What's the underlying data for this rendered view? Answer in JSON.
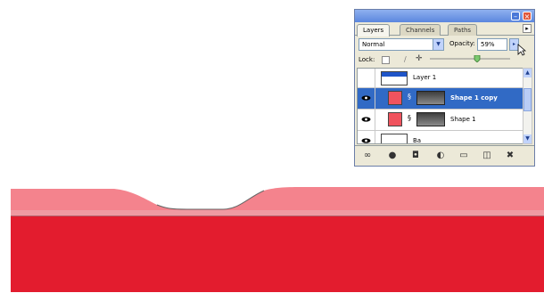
{
  "canvas": {
    "colors": {
      "background": "#ffffff",
      "main_shape": "#e31c2e",
      "shape_copy": "#f4838d",
      "band": "#ef9aa2"
    }
  },
  "layers_panel": {
    "tabs": [
      {
        "label": "Layers",
        "active": true
      },
      {
        "label": "Channels",
        "active": false
      },
      {
        "label": "Paths",
        "active": false
      }
    ],
    "blend_mode": "Normal",
    "opacity_label": "Opacity:",
    "opacity_value": "59%",
    "lock_label": "Lock:",
    "layers": [
      {
        "name": "Layer 1",
        "visible": false,
        "selected": false
      },
      {
        "name": "Shape 1 copy",
        "visible": true,
        "selected": true
      },
      {
        "name": "Shape 1",
        "visible": true,
        "selected": false
      },
      {
        "name": "Ba",
        "visible": true,
        "selected": false
      }
    ],
    "bottom_icons": [
      "link-icon",
      "layer-style-icon",
      "mask-icon",
      "adjustment-icon",
      "group-icon",
      "new-layer-icon",
      "trash-icon"
    ]
  }
}
